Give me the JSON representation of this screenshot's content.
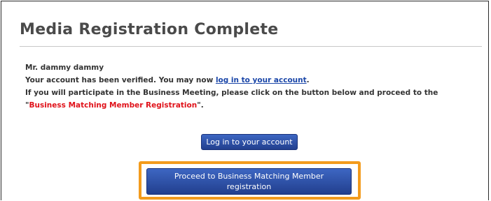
{
  "page": {
    "title": "Media Registration Complete"
  },
  "message": {
    "greeting": "Mr. dammy dammy",
    "verified_prefix": "Your account has been verified. You may now ",
    "verified_link": "log in to your account",
    "verified_suffix": ".",
    "participate_text": "If you will participate in the Business Meeting, please click on the button below and proceed to the",
    "quote_open": "\"",
    "highlight": "Business Matching Member Registration",
    "quote_close": "\"."
  },
  "buttons": {
    "login_label": "Log in to your account",
    "proceed_label": "Proceed to Business Matching Member registration"
  },
  "colors": {
    "link": "#1a46a8",
    "highlight": "#e0121a",
    "button": "#2b4ea6",
    "focus_frame": "#f39b1c"
  }
}
